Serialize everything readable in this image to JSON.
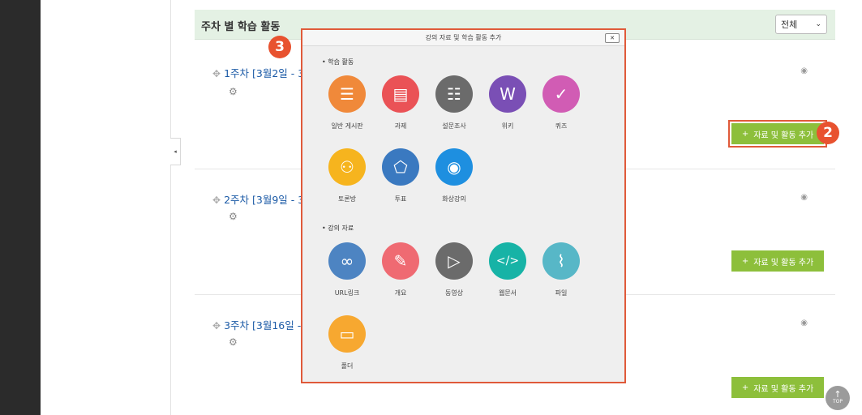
{
  "header": {
    "title": "주차 별 학습 활동",
    "filter_value": "전체"
  },
  "weeks": [
    {
      "title": "1주차 [3월2일 - 3",
      "add_label": "자료 및 활동 추가"
    },
    {
      "title": "2주차 [3월9일 - 3",
      "add_label": "자료 및 활동 추가"
    },
    {
      "title": "3주차 [3월16일 - 3",
      "add_label": "자료 및 활동 추가"
    }
  ],
  "badges": {
    "step2": "2",
    "step3": "3"
  },
  "top_button": {
    "label": "TOP"
  },
  "modal": {
    "title": "강의 자료 및 학습 활동 추가",
    "close": "✕",
    "activities_label": "• 학습 활동",
    "materials_label": "• 강의 자료",
    "activities": [
      {
        "label": "일반 게시판",
        "color": "#f0893a",
        "icon": "list-icon"
      },
      {
        "label": "과제",
        "color": "#ea5256",
        "icon": "document-icon"
      },
      {
        "label": "설문조사",
        "color": "#6b6b6b",
        "icon": "checklist-icon"
      },
      {
        "label": "위키",
        "color": "#7a4fb5",
        "icon": "wiki-icon"
      },
      {
        "label": "퀴즈",
        "color": "#d15cb4",
        "icon": "check-circle-icon"
      },
      {
        "label": "토론방",
        "color": "#f6b41e",
        "icon": "people-icon"
      },
      {
        "label": "투표",
        "color": "#3a79c0",
        "icon": "eraser-icon"
      },
      {
        "label": "화상강의",
        "color": "#1e8fe0",
        "icon": "video-chat-icon"
      }
    ],
    "materials": [
      {
        "label": "URL링크",
        "color": "#4d84c2",
        "icon": "link-icon"
      },
      {
        "label": "개요",
        "color": "#ef6a72",
        "icon": "pencil-icon"
      },
      {
        "label": "동영상",
        "color": "#6b6b6b",
        "icon": "play-icon"
      },
      {
        "label": "웹문서",
        "color": "#17b3a6",
        "icon": "code-icon"
      },
      {
        "label": "파일",
        "color": "#57b7c7",
        "icon": "paperclip-icon"
      },
      {
        "label": "폴더",
        "color": "#f7a830",
        "icon": "folder-icon"
      }
    ]
  }
}
